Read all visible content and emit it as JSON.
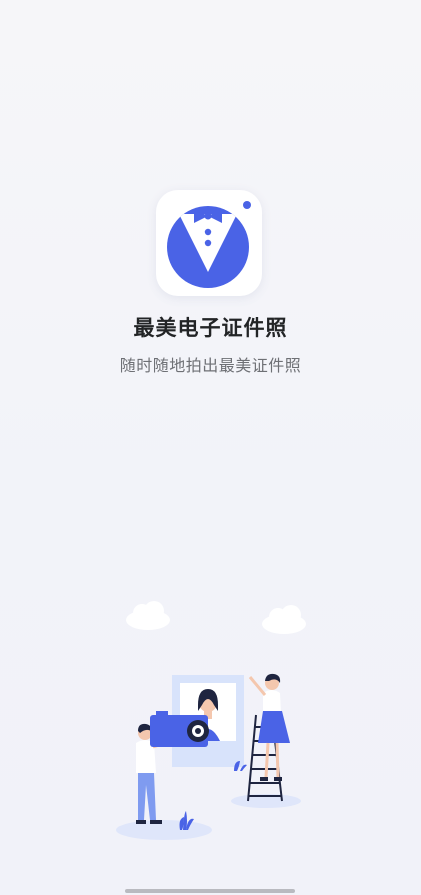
{
  "app": {
    "name": "最美电子证件照",
    "slogan": "随时随地拍出最美证件照",
    "icon": "tuxedo-bowtie-logo-icon"
  },
  "colors": {
    "brand_blue": "#4a63e6",
    "light_blue": "#e7edfb",
    "title_text": "#222426",
    "subtitle_text": "#6e7075",
    "background": "#f3f4f9"
  },
  "illustration": {
    "subject": "photographer-and-portrait-illustration",
    "icons": [
      "cloud-icon",
      "camera-icon",
      "portrait-frame-icon",
      "ladder-icon",
      "person-icon"
    ]
  }
}
